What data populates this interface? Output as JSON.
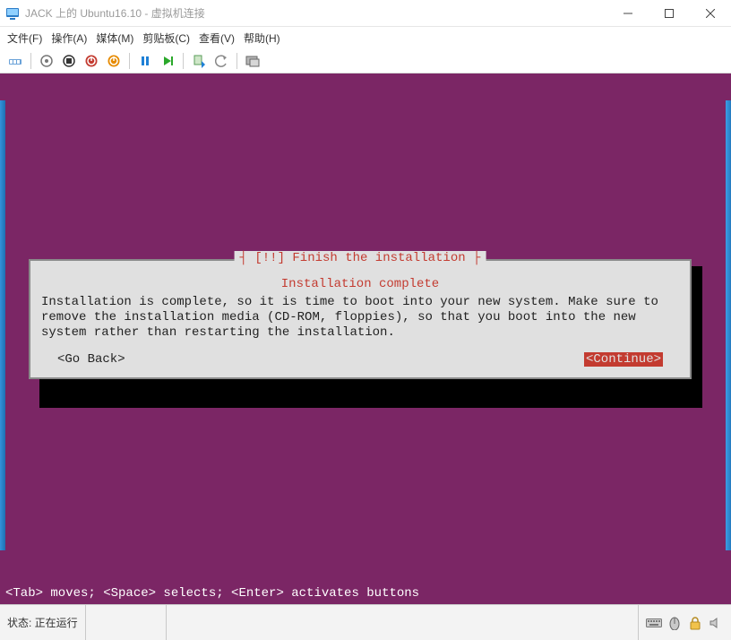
{
  "window": {
    "title": "JACK 上的 Ubuntu16.10 - 虚拟机连接"
  },
  "menu": {
    "file": "文件(F)",
    "action": "操作(A)",
    "media": "媒体(M)",
    "clip": "剪贴板(C)",
    "view": "查看(V)",
    "help": "帮助(H)"
  },
  "installer": {
    "frame_title": "┤ [!!] Finish the installation ├",
    "subtitle": "Installation complete",
    "body": "Installation is complete, so it is time to boot into your new system. Make sure to remove the installation media (CD-ROM, floppies), so that you boot into the new system rather than restarting the installation.",
    "go_back": "<Go Back>",
    "continue": "<Continue>",
    "hint": "<Tab> moves; <Space> selects; <Enter> activates buttons"
  },
  "status": {
    "label": "状态: 正在运行"
  },
  "colors": {
    "vm_bg": "#7b2665",
    "accent_red": "#c33b30",
    "dialog_bg": "#e0e0e0"
  }
}
